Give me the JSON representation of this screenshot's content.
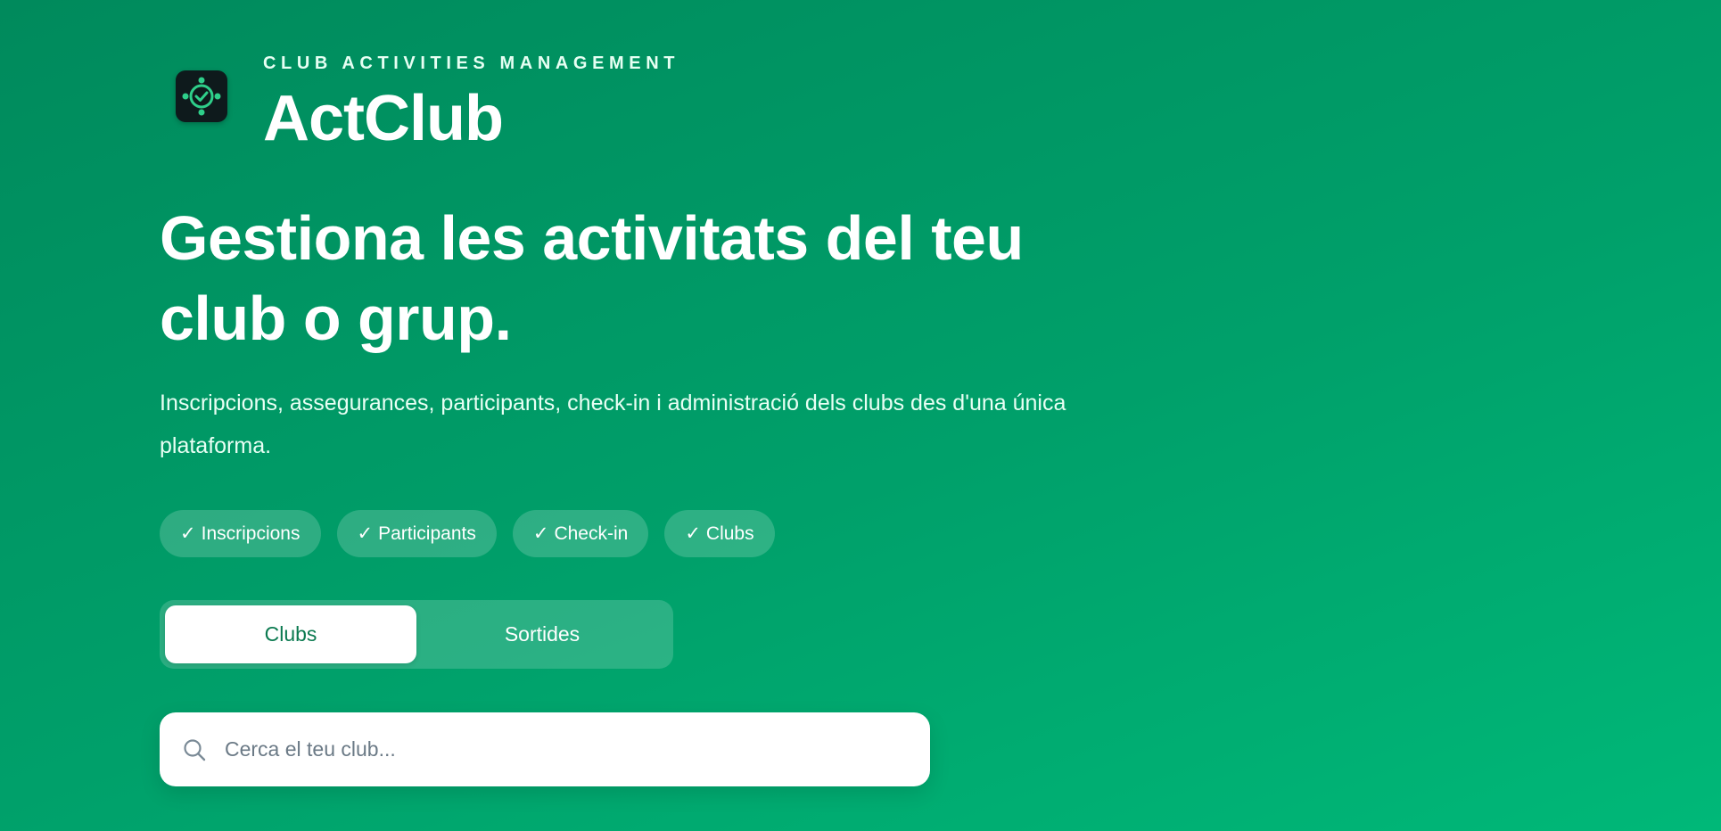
{
  "brand": {
    "eyebrow": "CLUB ACTIVITIES MANAGEMENT",
    "name": "ActClub",
    "logo_icon": "group-check-icon",
    "logo_color": "#2ecf8a"
  },
  "hero": {
    "headline": "Gestiona les activitats del teu club o grup.",
    "subtitle": "Inscripcions, assegurances, participants, check-in i administració dels clubs des d'una única plataforma."
  },
  "features": [
    {
      "check": "✓",
      "label": "Inscripcions"
    },
    {
      "check": "✓",
      "label": "Participants"
    },
    {
      "check": "✓",
      "label": "Check-in"
    },
    {
      "check": "✓",
      "label": "Clubs"
    }
  ],
  "toggle": {
    "options": [
      {
        "label": "Clubs",
        "active": true
      },
      {
        "label": "Sortides",
        "active": false
      }
    ]
  },
  "search": {
    "placeholder": "Cerca el teu club...",
    "value": "",
    "icon": "search-icon"
  },
  "colors": {
    "background_start": "#008a5c",
    "background_end": "#00b878",
    "accent_text": "#0b7a50"
  }
}
